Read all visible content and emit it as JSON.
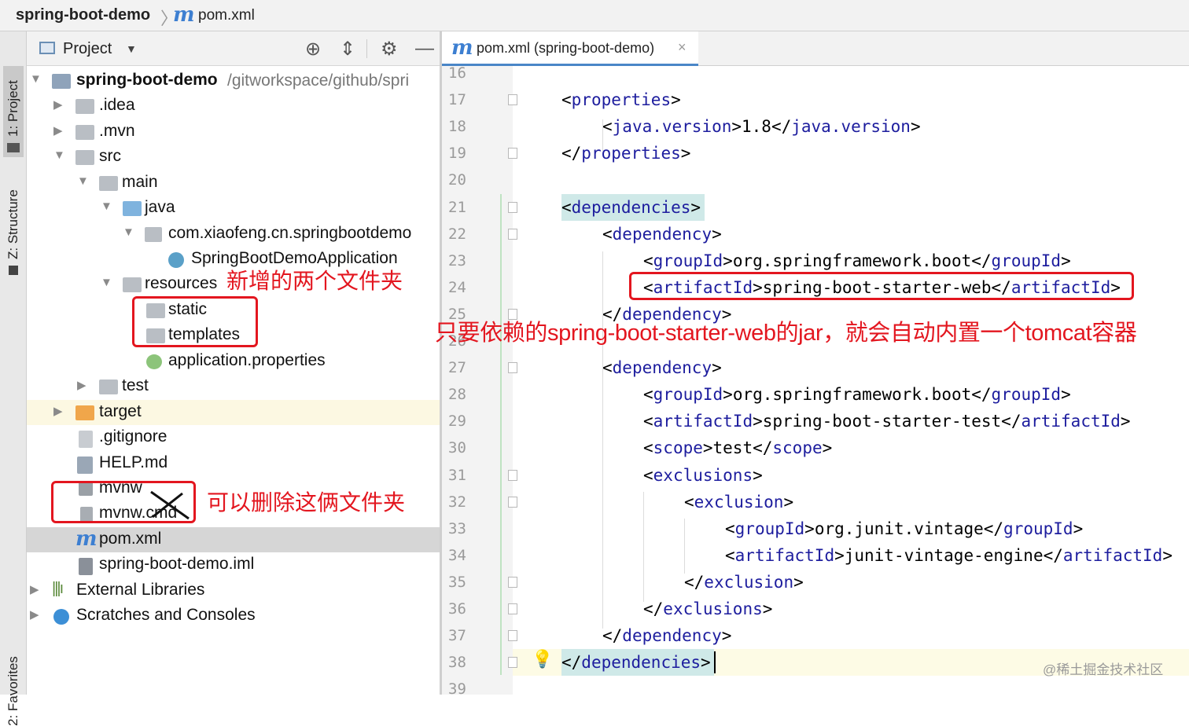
{
  "breadcrumb": {
    "project": "spring-boot-demo",
    "separator": "〉",
    "file_icon": "maven-file-icon",
    "file": "pom.xml"
  },
  "side_tabs": {
    "project": "1: Project",
    "structure": "Z: Structure",
    "favorites": "2: Favorites"
  },
  "project_panel": {
    "title": "Project",
    "toolbar_icons": [
      "locate-icon",
      "collapse-icon",
      "settings-icon",
      "hide-icon"
    ],
    "tree": [
      {
        "label": "spring-boot-demo",
        "path": " /gitworkspace/github/spri",
        "icon": "module-folder-icon"
      },
      {
        "label": ".idea",
        "icon": "folder-icon"
      },
      {
        "label": ".mvn",
        "icon": "folder-icon"
      },
      {
        "label": "src",
        "icon": "folder-icon"
      },
      {
        "label": "main",
        "icon": "folder-icon"
      },
      {
        "label": "java",
        "icon": "source-folder-icon"
      },
      {
        "label": "com.xiaofeng.cn.springbootdemo",
        "icon": "package-icon"
      },
      {
        "label": "SpringBootDemoApplication",
        "icon": "spring-boot-class-icon"
      },
      {
        "label": "resources",
        "icon": "resources-folder-icon"
      },
      {
        "label": "static",
        "icon": "folder-icon"
      },
      {
        "label": "templates",
        "icon": "folder-icon"
      },
      {
        "label": "application.properties",
        "icon": "spring-properties-icon"
      },
      {
        "label": "test",
        "icon": "folder-icon"
      },
      {
        "label": "target",
        "icon": "excluded-folder-icon"
      },
      {
        "label": ".gitignore",
        "icon": "ignore-file-icon"
      },
      {
        "label": "HELP.md",
        "icon": "markdown-file-icon"
      },
      {
        "label": "mvnw",
        "icon": "shell-script-icon"
      },
      {
        "label": "mvnw.cmd",
        "icon": "text-file-icon"
      },
      {
        "label": "pom.xml",
        "icon": "maven-file-icon"
      },
      {
        "label": "spring-boot-demo.iml",
        "icon": "iml-file-icon"
      },
      {
        "label": "External Libraries",
        "icon": "libraries-icon"
      },
      {
        "label": "Scratches and Consoles",
        "icon": "scratches-icon"
      }
    ]
  },
  "editor": {
    "tab": {
      "label": "pom.xml (spring-boot-demo)",
      "close": "×"
    },
    "lines": [
      {
        "n": "16",
        "code": []
      },
      {
        "n": "17",
        "code": [
          [
            "p",
            "<"
          ],
          [
            "t",
            "properties"
          ],
          [
            "p",
            ">"
          ]
        ]
      },
      {
        "n": "18",
        "code": [
          [
            "p",
            "<"
          ],
          [
            "t",
            "java.version"
          ],
          [
            "p",
            ">1.8</"
          ],
          [
            "t",
            "java.version"
          ],
          [
            "p",
            ">"
          ]
        ]
      },
      {
        "n": "19",
        "code": [
          [
            "p",
            "</"
          ],
          [
            "t",
            "properties"
          ],
          [
            "p",
            ">"
          ]
        ]
      },
      {
        "n": "20",
        "code": []
      },
      {
        "n": "21",
        "code": [
          [
            "p",
            "<"
          ],
          [
            "t",
            "dependencies"
          ],
          [
            "p",
            ">"
          ]
        ]
      },
      {
        "n": "22",
        "code": [
          [
            "p",
            "<"
          ],
          [
            "t",
            "dependency"
          ],
          [
            "p",
            ">"
          ]
        ]
      },
      {
        "n": "23",
        "code": [
          [
            "p",
            "<"
          ],
          [
            "t",
            "groupId"
          ],
          [
            "p",
            ">org.springframework.boot</"
          ],
          [
            "t",
            "groupId"
          ],
          [
            "p",
            ">"
          ]
        ]
      },
      {
        "n": "24",
        "code": [
          [
            "p",
            "<"
          ],
          [
            "t",
            "artifactId"
          ],
          [
            "p",
            ">spring-boot-starter-web</"
          ],
          [
            "t",
            "artifactId"
          ],
          [
            "p",
            ">"
          ]
        ]
      },
      {
        "n": "25",
        "code": [
          [
            "p",
            "</"
          ],
          [
            "t",
            "dependency"
          ],
          [
            "p",
            ">"
          ]
        ]
      },
      {
        "n": "26",
        "code": []
      },
      {
        "n": "27",
        "code": [
          [
            "p",
            "<"
          ],
          [
            "t",
            "dependency"
          ],
          [
            "p",
            ">"
          ]
        ]
      },
      {
        "n": "28",
        "code": [
          [
            "p",
            "<"
          ],
          [
            "t",
            "groupId"
          ],
          [
            "p",
            ">org.springframework.boot</"
          ],
          [
            "t",
            "groupId"
          ],
          [
            "p",
            ">"
          ]
        ]
      },
      {
        "n": "29",
        "code": [
          [
            "p",
            "<"
          ],
          [
            "t",
            "artifactId"
          ],
          [
            "p",
            ">spring-boot-starter-test</"
          ],
          [
            "t",
            "artifactId"
          ],
          [
            "p",
            ">"
          ]
        ]
      },
      {
        "n": "30",
        "code": [
          [
            "p",
            "<"
          ],
          [
            "t",
            "scope"
          ],
          [
            "p",
            ">test</"
          ],
          [
            "t",
            "scope"
          ],
          [
            "p",
            ">"
          ]
        ]
      },
      {
        "n": "31",
        "code": [
          [
            "p",
            "<"
          ],
          [
            "t",
            "exclusions"
          ],
          [
            "p",
            ">"
          ]
        ]
      },
      {
        "n": "32",
        "code": [
          [
            "p",
            "<"
          ],
          [
            "t",
            "exclusion"
          ],
          [
            "p",
            ">"
          ]
        ]
      },
      {
        "n": "33",
        "code": [
          [
            "p",
            "<"
          ],
          [
            "t",
            "groupId"
          ],
          [
            "p",
            ">org.junit.vintage</"
          ],
          [
            "t",
            "groupId"
          ],
          [
            "p",
            ">"
          ]
        ]
      },
      {
        "n": "34",
        "code": [
          [
            "p",
            "<"
          ],
          [
            "t",
            "artifactId"
          ],
          [
            "p",
            ">junit-vintage-engine</"
          ],
          [
            "t",
            "artifactId"
          ],
          [
            "p",
            ">"
          ]
        ]
      },
      {
        "n": "35",
        "code": [
          [
            "p",
            "</"
          ],
          [
            "t",
            "exclusion"
          ],
          [
            "p",
            ">"
          ]
        ]
      },
      {
        "n": "36",
        "code": [
          [
            "p",
            "</"
          ],
          [
            "t",
            "exclusions"
          ],
          [
            "p",
            ">"
          ]
        ]
      },
      {
        "n": "37",
        "code": [
          [
            "p",
            "</"
          ],
          [
            "t",
            "dependency"
          ],
          [
            "p",
            ">"
          ]
        ]
      },
      {
        "n": "38",
        "code": [
          [
            "p",
            "</"
          ],
          [
            "t",
            "dependencies"
          ],
          [
            "p",
            ">"
          ]
        ]
      },
      {
        "n": "39",
        "code": []
      }
    ],
    "intention_icon": "lightbulb-icon"
  },
  "annotations": {
    "new_folders": "新增的两个文件夹",
    "starter_web": "只要依赖的spring-boot-starter-web的jar，就会自动内置一个tomcat容器",
    "can_delete": "可以删除这俩文件夹"
  },
  "watermark": "@稀土掘金技术社区",
  "colors": {
    "tag": "#1d1d9e",
    "annotation_red": "#e3161f",
    "accent_blue": "#3d7fd1",
    "match_highlight": "#cfe9e8"
  }
}
